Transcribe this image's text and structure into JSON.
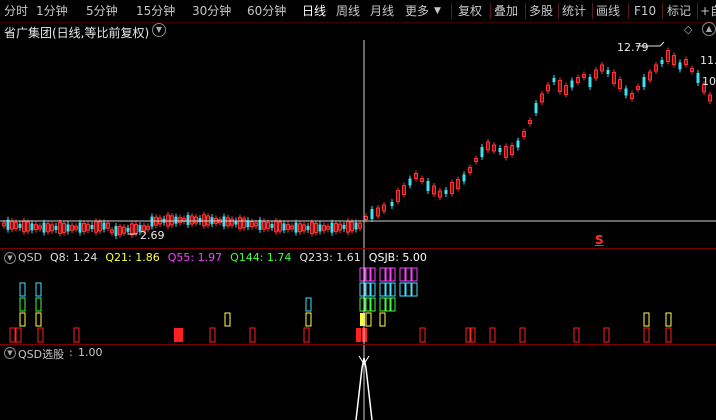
{
  "toolbar": {
    "items": [
      "分时",
      "1分钟",
      "5分钟",
      "15分钟",
      "30分钟",
      "60分钟",
      "日线",
      "周线",
      "月线",
      "更多"
    ],
    "active": "日线",
    "right_items": [
      "复权",
      "叠加",
      "多股",
      "统计",
      "画线",
      "F10",
      "标记",
      "+自"
    ]
  },
  "title": {
    "stock_name": "省广集团",
    "period_text": "(日线,等比前复权)"
  },
  "price_labels": {
    "high_label": "12.79",
    "low_label": "2.69",
    "right_label_1": "11.",
    "right_label_2": "10"
  },
  "signal_mark": "S",
  "indicator_qsd": {
    "name": "QSD",
    "values": [
      {
        "label": "Q8",
        "value": "1.24",
        "color": "#e0e0e0"
      },
      {
        "label": "Q21",
        "value": "1.86",
        "color": "#ffff40"
      },
      {
        "label": "Q55",
        "value": "1.97",
        "color": "#ff40ff"
      },
      {
        "label": "Q144",
        "value": "1.74",
        "color": "#40ff40"
      },
      {
        "label": "Q233",
        "value": "1.61",
        "color": "#e0e0e0"
      },
      {
        "label": "QSJB",
        "value": "5.00",
        "color": "#ffffff"
      }
    ]
  },
  "indicator_select": {
    "name": "QSD选股",
    "value": "1.00"
  },
  "colors": {
    "up": "#ff3030",
    "down": "#40e0f0",
    "background": "#000000",
    "grid": "#7a0000",
    "crosshair": "#d0d0d0"
  },
  "chart_data": {
    "type": "candlestick",
    "y_ticks_visible": false,
    "price_markers": {
      "high": 12.79,
      "low": 2.69
    },
    "qsd_series": {
      "Q8": 1.24,
      "Q21": 1.86,
      "Q55": 1.97,
      "Q144": 1.74,
      "Q233": 1.61,
      "QSJB": 5.0
    },
    "select_value": 1.0
  }
}
